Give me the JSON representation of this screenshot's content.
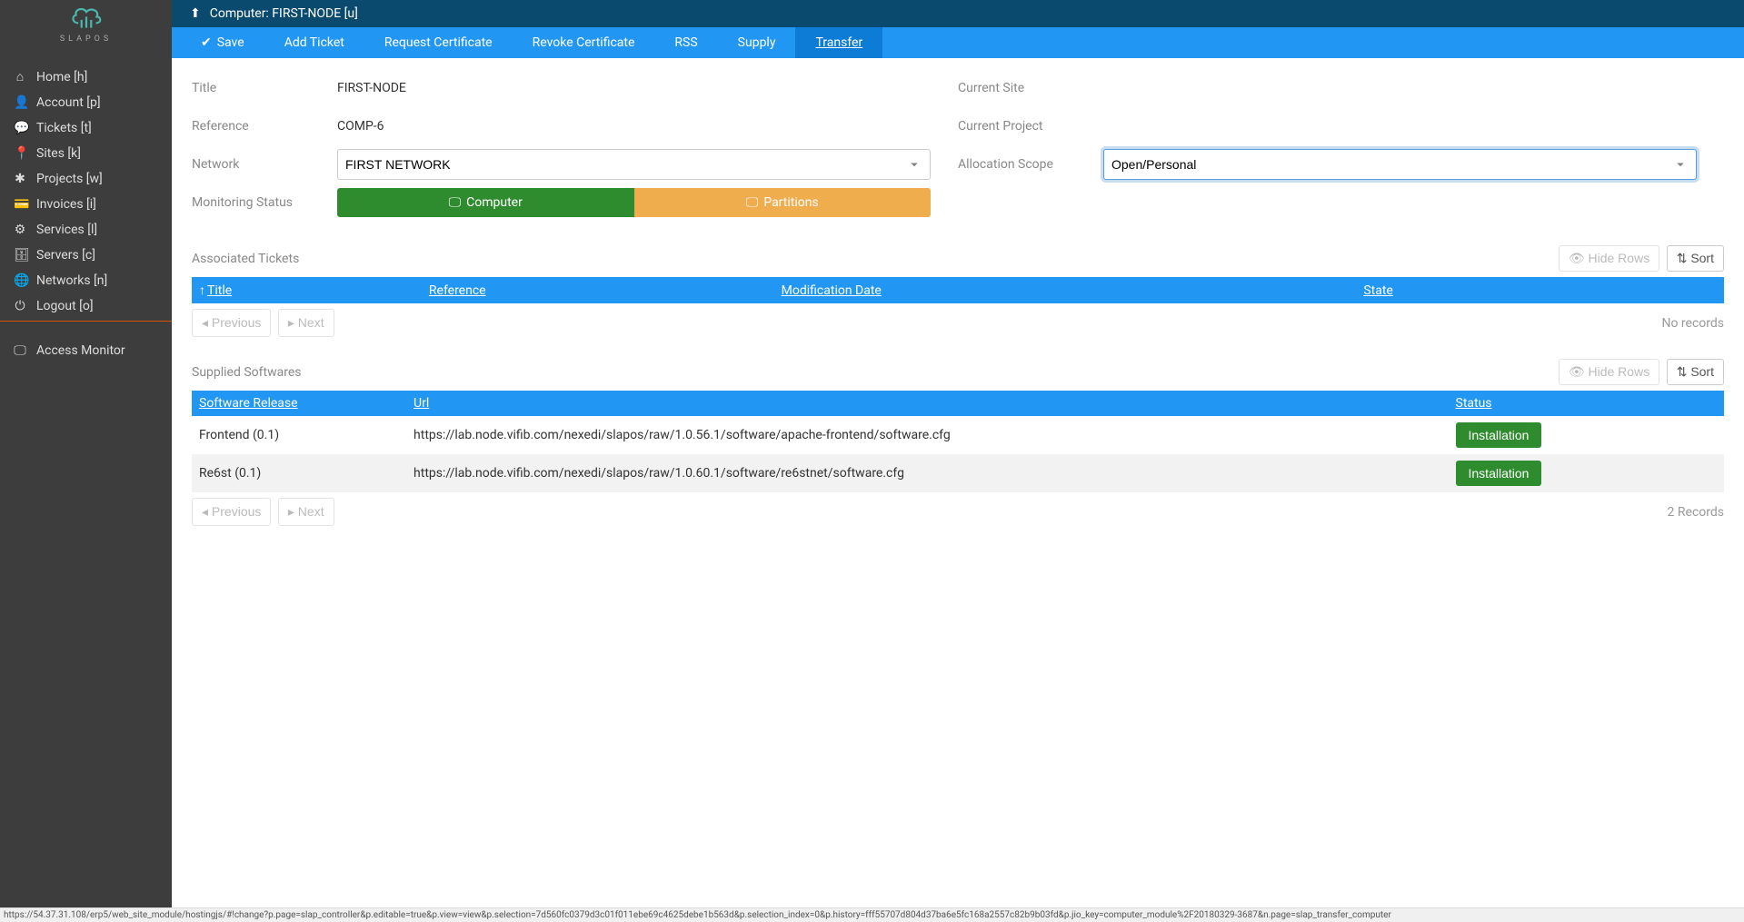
{
  "logo_text": "SLAPOS",
  "sidebar": {
    "items": [
      {
        "label": "Home [h]",
        "icon": "home"
      },
      {
        "label": "Account [p]",
        "icon": "user"
      },
      {
        "label": "Tickets [t]",
        "icon": "comments"
      },
      {
        "label": "Sites [k]",
        "icon": "marker"
      },
      {
        "label": "Projects [w]",
        "icon": "share"
      },
      {
        "label": "Invoices [i]",
        "icon": "card"
      },
      {
        "label": "Services [l]",
        "icon": "cogs"
      },
      {
        "label": "Servers [c]",
        "icon": "db"
      },
      {
        "label": "Networks [n]",
        "icon": "globe"
      },
      {
        "label": "Logout [o]",
        "icon": "power"
      }
    ],
    "monitor_label": "Access Monitor"
  },
  "header": {
    "breadcrumb": "Computer: FIRST-NODE [u]"
  },
  "tabs": [
    {
      "label": "Save",
      "check": true
    },
    {
      "label": "Add Ticket"
    },
    {
      "label": "Request Certificate"
    },
    {
      "label": "Revoke Certificate"
    },
    {
      "label": "RSS"
    },
    {
      "label": "Supply"
    },
    {
      "label": "Transfer"
    }
  ],
  "fields": {
    "title_label": "Title",
    "title_value": "FIRST-NODE",
    "reference_label": "Reference",
    "reference_value": "COMP-6",
    "network_label": "Network",
    "network_value": "FIRST NETWORK",
    "monitoring_label": "Monitoring Status",
    "computer_btn": "Computer",
    "partitions_btn": "Partitions",
    "currentsite_label": "Current Site",
    "currentsite_value": "",
    "currentproject_label": "Current Project",
    "currentproject_value": "",
    "allocscope_label": "Allocation Scope",
    "allocscope_value": "Open/Personal"
  },
  "tickets": {
    "title": "Associated Tickets",
    "hide_btn": "Hide Rows",
    "sort_btn": "Sort",
    "cols": {
      "title": "Title",
      "reference": "Reference",
      "moddate": "Modification Date",
      "state": "State"
    },
    "prev": "Previous",
    "next": "Next",
    "empty": "No records"
  },
  "software": {
    "title": "Supplied Softwares",
    "hide_btn": "Hide Rows",
    "sort_btn": "Sort",
    "cols": {
      "release": "Software Release",
      "url": "Url",
      "status": "Status"
    },
    "rows": [
      {
        "release": "Frontend (0.1)",
        "url": "https://lab.node.vifib.com/nexedi/slapos/raw/1.0.56.1/software/apache-frontend/software.cfg",
        "status": "Installation"
      },
      {
        "release": "Re6st (0.1)",
        "url": "https://lab.node.vifib.com/nexedi/slapos/raw/1.0.60.1/software/re6stnet/software.cfg",
        "status": "Installation"
      }
    ],
    "prev": "Previous",
    "next": "Next",
    "count": "2 Records"
  },
  "statusbar": "https://54.37.31.108/erp5/web_site_module/hostingjs/#!change?p.page=slap_controller&p.editable=true&p.view=view&p.selection=7d560fc0379d3c01f011ebe69c4625debe1b563d&p.selection_index=0&p.history=fff55707d804d37ba6e5fc168a2557c82b9b03fd&p.jio_key=computer_module%2F20180329-3687&n.page=slap_transfer_computer"
}
